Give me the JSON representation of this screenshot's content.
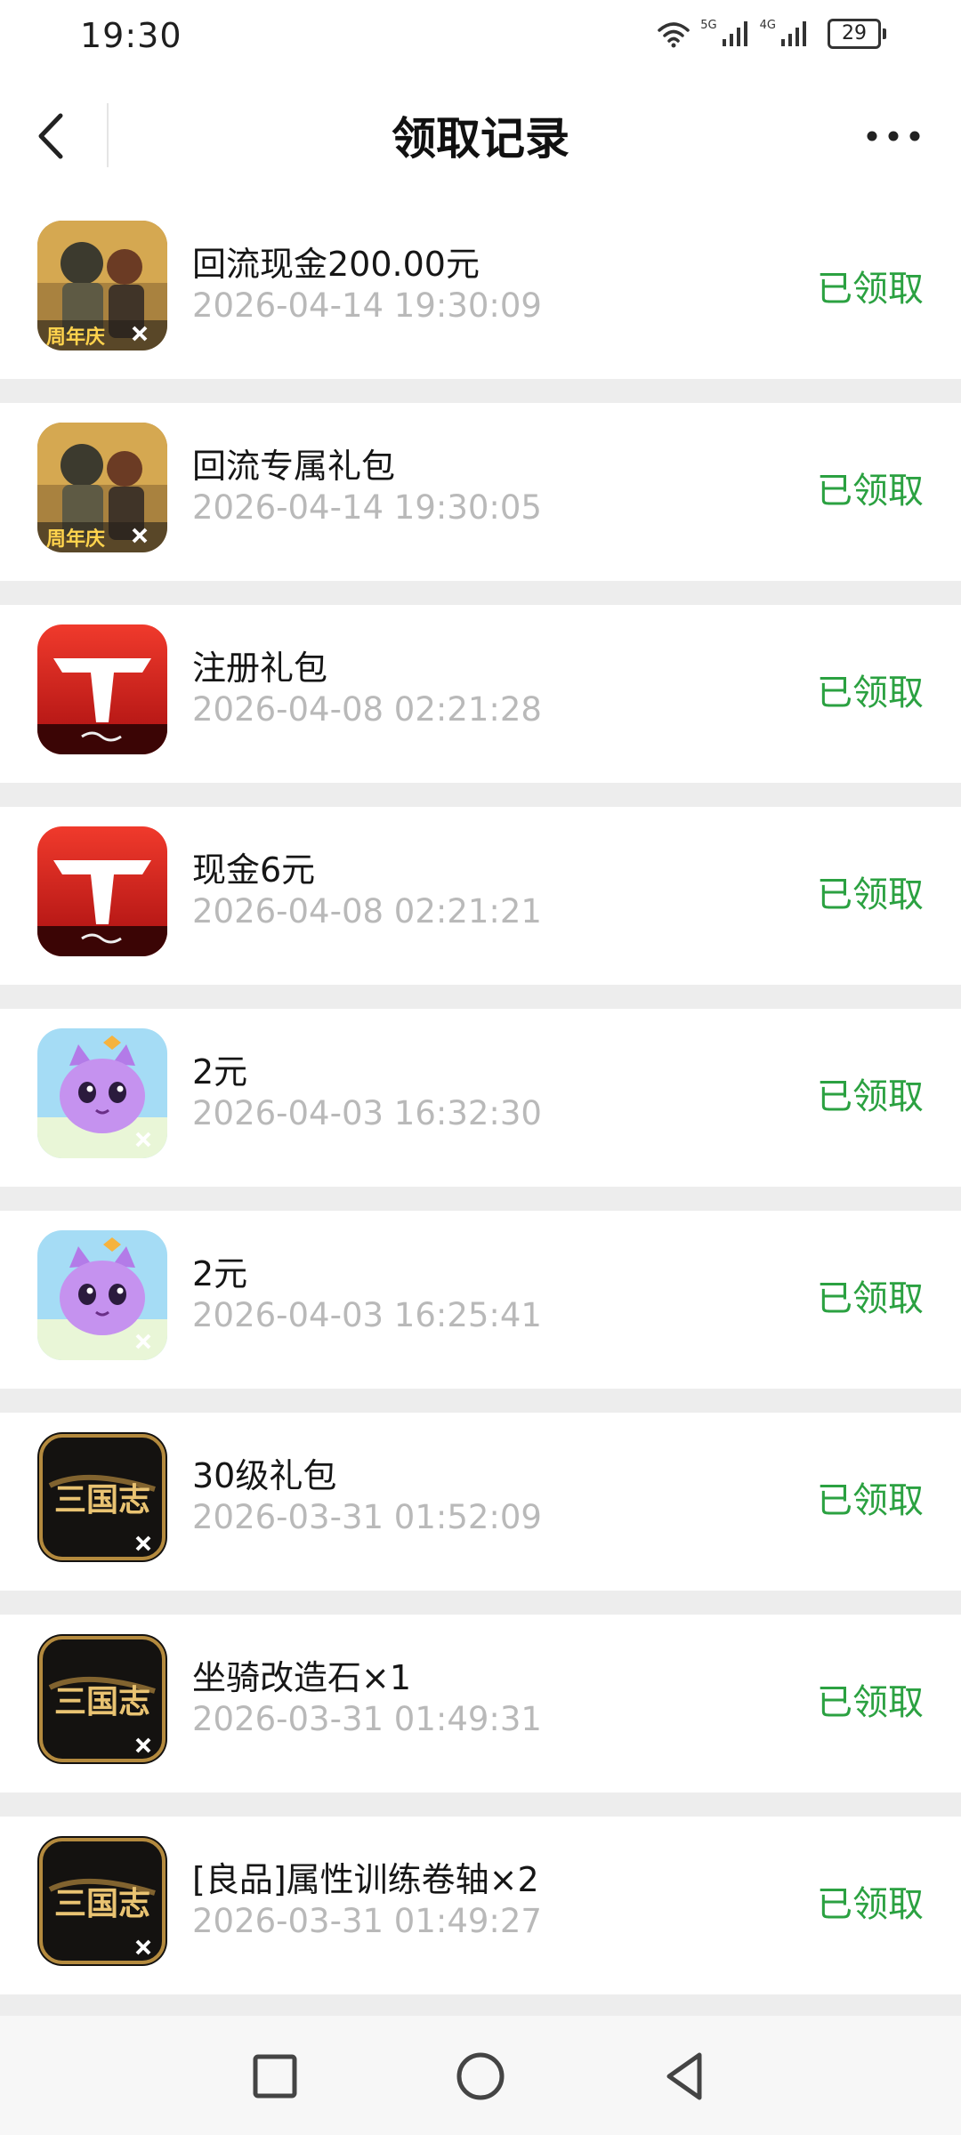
{
  "status_bar": {
    "time": "19:30",
    "signal_1_label": "5G",
    "signal_2_label": "4G",
    "battery": "29"
  },
  "nav": {
    "title": "领取记录"
  },
  "records": [
    {
      "icon": "pubg-anniversary-icon",
      "title": "回流现金200.00元",
      "time": "2026-04-14 19:30:09",
      "status": "已领取",
      "icon_caption": "周年庆"
    },
    {
      "icon": "pubg-anniversary-icon",
      "title": "回流专属礼包",
      "time": "2026-04-14 19:30:05",
      "status": "已领取",
      "icon_caption": "周年庆"
    },
    {
      "icon": "red-tf-game-icon",
      "title": "注册礼包",
      "time": "2026-04-08 02:21:28",
      "status": "已领取"
    },
    {
      "icon": "red-tf-game-icon",
      "title": "现金6元",
      "time": "2026-04-08 02:21:21",
      "status": "已领取"
    },
    {
      "icon": "purple-cat-game-icon",
      "title": "2元",
      "time": "2026-04-03 16:32:30",
      "status": "已领取"
    },
    {
      "icon": "purple-cat-game-icon",
      "title": "2元",
      "time": "2026-04-03 16:25:41",
      "status": "已领取"
    },
    {
      "icon": "sanguozhi-game-icon",
      "title": "30级礼包",
      "time": "2026-03-31 01:52:09",
      "status": "已领取",
      "icon_caption": "三国志"
    },
    {
      "icon": "sanguozhi-game-icon",
      "title": "坐骑改造石×1",
      "time": "2026-03-31 01:49:31",
      "status": "已领取",
      "icon_caption": "三国志"
    },
    {
      "icon": "sanguozhi-game-icon",
      "title": "[良品]属性训练卷轴×2",
      "time": "2026-03-31 01:49:27",
      "status": "已领取",
      "icon_caption": "三国志"
    }
  ],
  "colors": {
    "status_green": "#2ba141",
    "time_gray": "#b9b9b9",
    "page_bg": "#ededed"
  }
}
